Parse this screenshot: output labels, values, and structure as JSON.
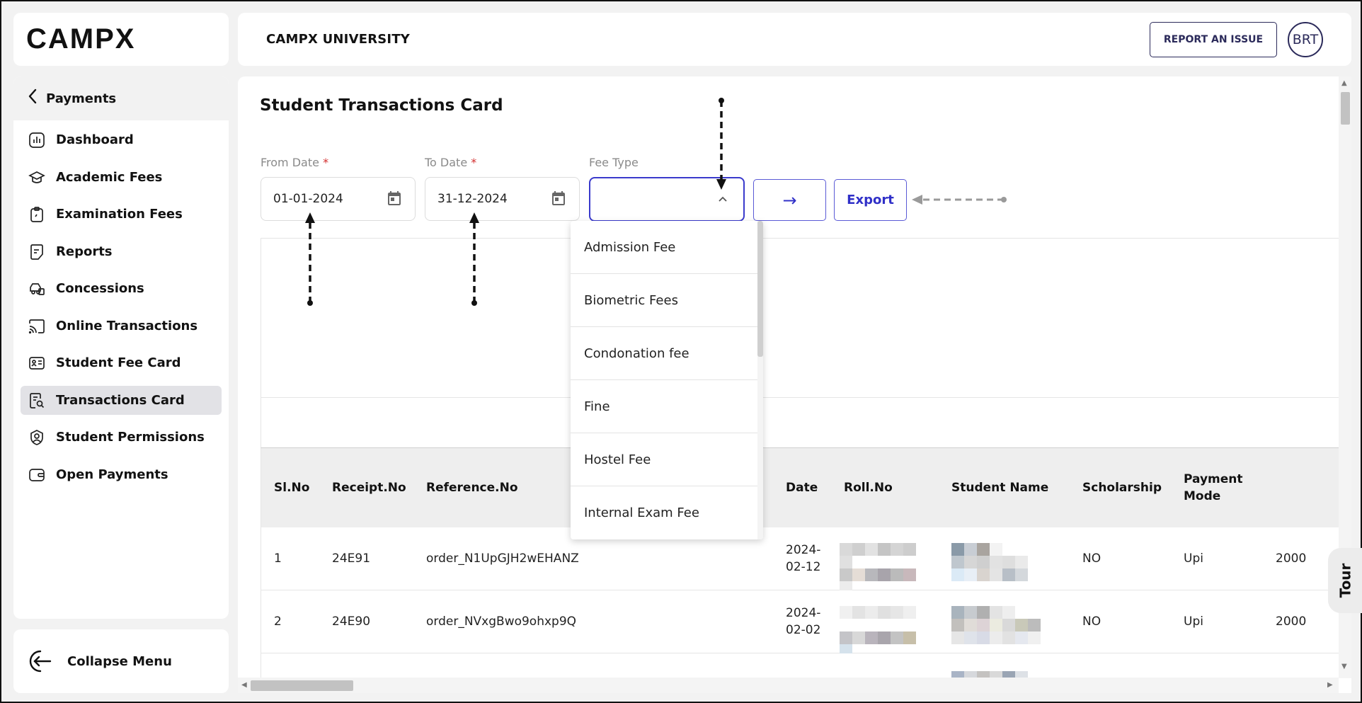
{
  "brand": {
    "logo_text": "CAMPX"
  },
  "header": {
    "title": "CAMPX UNIVERSITY",
    "report_button": "REPORT AN ISSUE",
    "avatar_initials": "BRT"
  },
  "sidebar": {
    "back_label": "Payments",
    "items": [
      {
        "label": "Dashboard",
        "icon": "chart-icon"
      },
      {
        "label": "Academic Fees",
        "icon": "graduation-cap-icon"
      },
      {
        "label": "Examination Fees",
        "icon": "clipboard-icon"
      },
      {
        "label": "Reports",
        "icon": "document-icon"
      },
      {
        "label": "Concessions",
        "icon": "car-icon"
      },
      {
        "label": "Online Transactions",
        "icon": "cast-icon"
      },
      {
        "label": "Student Fee Card",
        "icon": "id-card-icon"
      },
      {
        "label": "Transactions Card",
        "icon": "receipt-search-icon",
        "active": true
      },
      {
        "label": "Student Permissions",
        "icon": "user-shield-icon"
      },
      {
        "label": "Open Payments",
        "icon": "wallet-icon"
      }
    ],
    "collapse_label": "Collapse Menu"
  },
  "main": {
    "title": "Student Transactions Card",
    "filters": {
      "from_date_label": "From Date",
      "from_date_value": "01-01-2024",
      "to_date_label": "To Date",
      "to_date_value": "31-12-2024",
      "required_mark": "*",
      "fee_type_label": "Fee Type",
      "fee_type_value": "",
      "go_arrow": "→",
      "export_label": "Export"
    },
    "fee_type_options": [
      "Admission Fee",
      "Biometric Fees",
      "Condonation fee",
      "Fine",
      "Hostel Fee",
      "Internal Exam Fee"
    ],
    "table": {
      "columns": [
        "Sl.No",
        "Receipt.No",
        "Reference.No",
        "Date",
        "Roll.No",
        "Student Name",
        "Scholarship",
        "Payment Mode"
      ],
      "rows": [
        {
          "sl": "1",
          "receipt": "24E91",
          "reference": "order_N1UpGJH2wEHANZ",
          "date_line1": "2024-",
          "date_line2": "02-12",
          "scholarship": "NO",
          "mode": "Upi",
          "amount": "2000"
        },
        {
          "sl": "2",
          "receipt": "24E90",
          "reference": "order_NVxgBwo9ohxp9Q",
          "date_line1": "2024-",
          "date_line2": "02-02",
          "scholarship": "NO",
          "mode": "Upi",
          "amount": "2000"
        }
      ]
    }
  },
  "tour_label": "Tour"
}
